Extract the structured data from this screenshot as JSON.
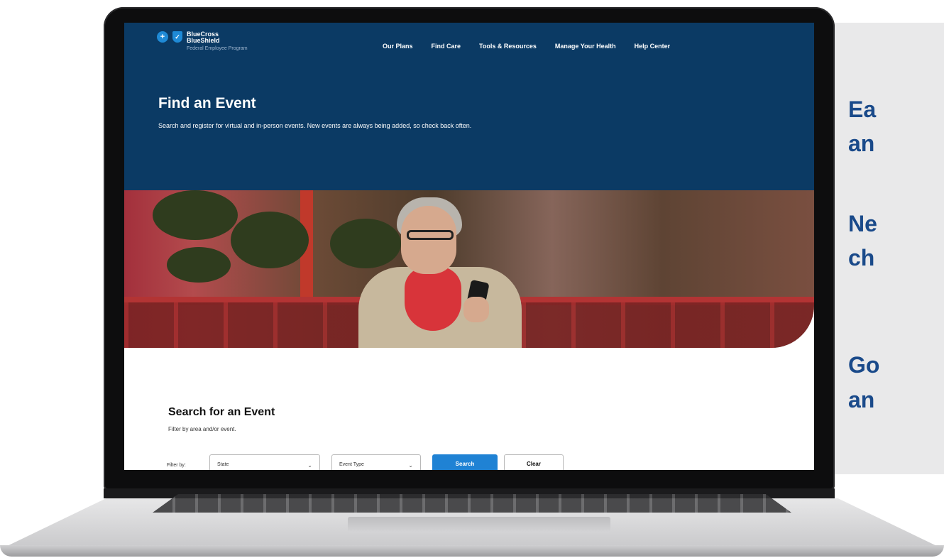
{
  "side_panel": {
    "lines": [
      "Ea",
      "an",
      "Ne",
      "ch",
      "Go",
      "an"
    ]
  },
  "site": {
    "logo": {
      "line1": "BlueCross",
      "line2": "BlueShield",
      "line3": "Federal Employee Program"
    },
    "nav": [
      "Our Plans",
      "Find Care",
      "Tools & Resources",
      "Manage Your Health",
      "Help Center"
    ],
    "page_title": "Find an Event",
    "page_description": "Search and register for virtual and in-person events. New events are always being added, so check back often.",
    "search": {
      "title": "Search for an Event",
      "description": "Filter by area and/or event.",
      "filter_label": "Filter by:",
      "state_select": "State",
      "event_type_select": "Event Type",
      "search_button": "Search",
      "clear_button": "Clear"
    }
  },
  "colors": {
    "header_bg": "#0b3a64",
    "side_text": "#1a4a8a",
    "search_button": "#1f82d4"
  }
}
